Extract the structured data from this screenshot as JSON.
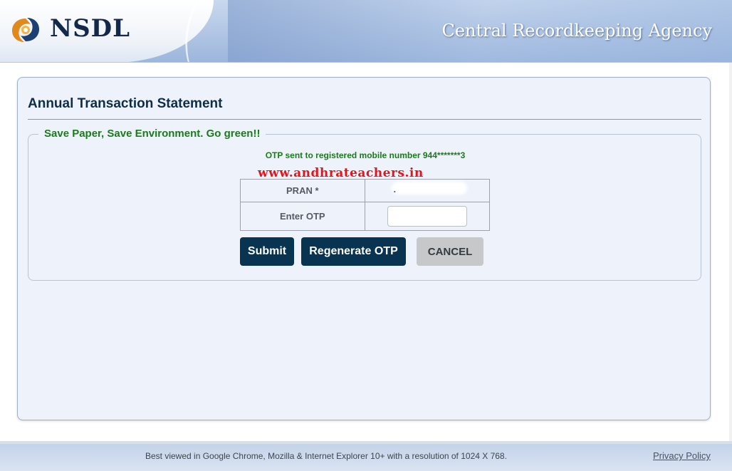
{
  "header": {
    "logo_text": "NSDL",
    "agency": "Central Recordkeeping Agency",
    "logo_icon": "nsdl-logo-icon"
  },
  "main": {
    "title": "Annual Transaction Statement",
    "legend": "Save Paper, Save Environment. Go green!!",
    "otp_message": "OTP sent to registered mobile number 944*******3",
    "watermark": "www.andhrateachers.in",
    "form": {
      "pran_label": "PRAN *",
      "pran_value": ".",
      "otp_label": "Enter OTP",
      "otp_value": "",
      "otp_placeholder": ""
    },
    "buttons": {
      "submit": "Submit",
      "regenerate": "Regenerate OTP",
      "cancel": "CANCEL"
    }
  },
  "footer": {
    "note": "Best viewed in Google Chrome, Mozilla & Internet Explorer 10+ with a resolution of 1024 X 768.",
    "privacy": "Privacy Policy"
  },
  "colors": {
    "brand_navy": "#083351",
    "title_text": "#0f2d47",
    "green_text": "#1b7a1b",
    "watermark_red": "#e4141c",
    "panel_bg": "#eef3fb"
  }
}
